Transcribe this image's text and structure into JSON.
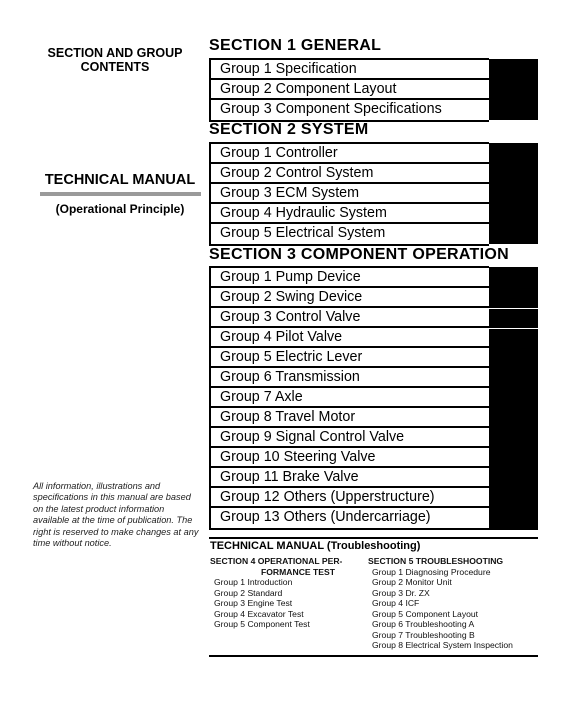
{
  "left": {
    "contents_title": "SECTION AND GROUP CONTENTS",
    "manual_title": "TECHNICAL MANUAL",
    "manual_subtitle": "(Operational Principle)",
    "disclaimer": "All information, illustrations and specifications in this manual are based on the latest product information available at the time of publication. The right is reserved to make changes at any time without notice."
  },
  "sections": [
    {
      "title": "SECTION 1 GENERAL",
      "groups": [
        "Group 1 Specification",
        "Group 2 Component Layout",
        "Group 3 Component Specifications"
      ]
    },
    {
      "title": "SECTION 2 SYSTEM",
      "groups": [
        "Group 1 Controller",
        "Group 2 Control System",
        "Group 3 ECM System",
        "Group 4 Hydraulic System",
        "Group 5 Electrical System"
      ]
    },
    {
      "title": "SECTION 3 COMPONENT OPERATION",
      "groups": [
        "Group 1 Pump Device",
        "Group 2 Swing Device",
        "Group 3 Control Valve",
        "Group 4 Pilot Valve",
        "Group 5 Electric Lever",
        "Group 6 Transmission",
        "Group 7 Axle",
        "Group 8 Travel Motor",
        "Group 9 Signal Control Valve",
        "Group 10 Steering Valve",
        "Group 11 Brake Valve",
        "Group 12 Others (Upperstructure)",
        "Group 13 Others (Undercarriage)"
      ]
    }
  ],
  "troubleshooting": {
    "title": "TECHNICAL MANUAL (Troubleshooting)",
    "section4": {
      "title_line1": "SECTION 4 OPERATIONAL PER-",
      "title_line2": "FORMANCE TEST",
      "groups": [
        "Group 1 Introduction",
        "Group 2 Standard",
        "Group 3 Engine Test",
        "Group 4 Excavator Test",
        "Group 5 Component Test"
      ]
    },
    "section5": {
      "title": "SECTION 5 TROUBLESHOOTING",
      "groups": [
        "Group 1 Diagnosing Procedure",
        "Group 2 Monitor Unit",
        "Group 3 Dr. ZX",
        "Group 4 ICF",
        "Group 5 Component Layout",
        "Group 6 Troubleshooting A",
        "Group 7 Troubleshooting B",
        "Group 8 Electrical System Inspection"
      ]
    }
  }
}
